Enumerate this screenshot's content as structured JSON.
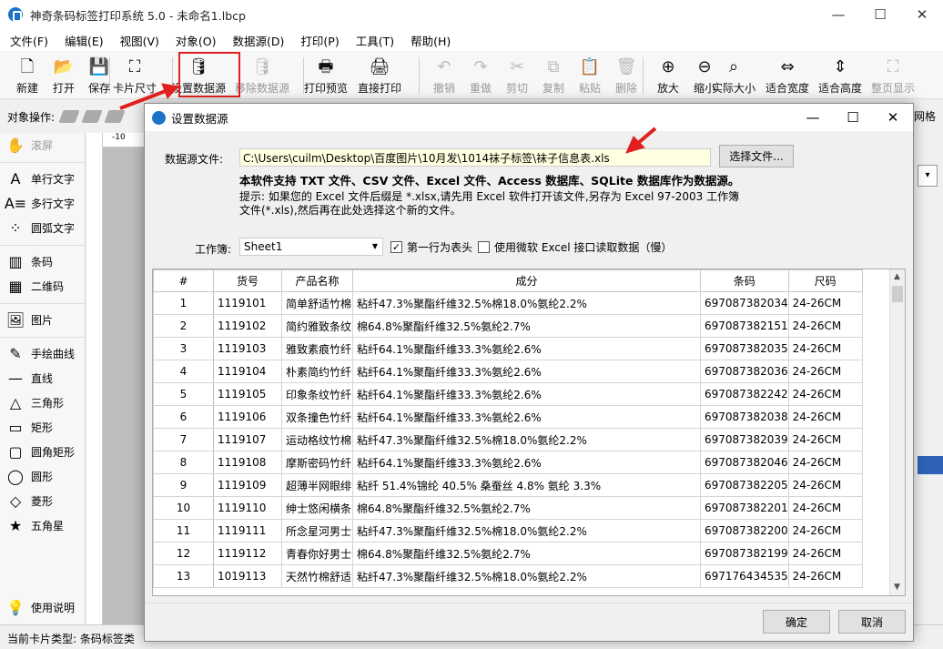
{
  "app": {
    "title": "神奇条码标签打印系统 5.0 - 未命名1.lbcp"
  },
  "window_controls": {
    "minimize": "—",
    "maximize": "☐",
    "close": "✕"
  },
  "menu": [
    "文件(F)",
    "编辑(E)",
    "视图(V)",
    "对象(O)",
    "数据源(D)",
    "打印(P)",
    "工具(T)",
    "帮助(H)"
  ],
  "toolbar": [
    {
      "label": "新建",
      "icon": "new-file-icon",
      "glyph": "🗋",
      "enabled": true
    },
    {
      "label": "打开",
      "icon": "open-icon",
      "glyph": "📂",
      "enabled": true
    },
    {
      "label": "保存",
      "icon": "save-icon",
      "glyph": "💾",
      "enabled": true
    },
    {
      "label": "卡片尺寸",
      "icon": "card-size-icon",
      "glyph": "⛶",
      "enabled": true
    },
    {
      "label": "设置数据源",
      "icon": "database-icon",
      "glyph": "🛢",
      "enabled": true
    },
    {
      "label": "移除数据源",
      "icon": "remove-database-icon",
      "glyph": "🛢",
      "enabled": false
    },
    {
      "label": "打印预览",
      "icon": "print-preview-icon",
      "glyph": "🖶",
      "enabled": true
    },
    {
      "label": "直接打印",
      "icon": "printer-icon",
      "glyph": "🖨",
      "enabled": true
    },
    {
      "label": "撤销",
      "icon": "undo-icon",
      "glyph": "↶",
      "enabled": false
    },
    {
      "label": "重做",
      "icon": "redo-icon",
      "glyph": "↷",
      "enabled": false
    },
    {
      "label": "剪切",
      "icon": "cut-icon",
      "glyph": "✂",
      "enabled": false
    },
    {
      "label": "复制",
      "icon": "copy-icon",
      "glyph": "⧉",
      "enabled": false
    },
    {
      "label": "粘贴",
      "icon": "paste-icon",
      "glyph": "📋",
      "enabled": false
    },
    {
      "label": "删除",
      "icon": "delete-icon",
      "glyph": "🗑",
      "enabled": false
    },
    {
      "label": "放大",
      "icon": "zoom-in-icon",
      "glyph": "⊕",
      "enabled": true
    },
    {
      "label": "缩小",
      "icon": "zoom-out-icon",
      "glyph": "⊖",
      "enabled": true
    },
    {
      "label": "实际大小",
      "icon": "actual-size-icon",
      "glyph": "⌕",
      "enabled": true
    },
    {
      "label": "适合宽度",
      "icon": "fit-width-icon",
      "glyph": "⇔",
      "enabled": true
    },
    {
      "label": "适合高度",
      "icon": "fit-height-icon",
      "glyph": "⇕",
      "enabled": true
    },
    {
      "label": "整页显示",
      "icon": "full-page-icon",
      "glyph": "⛶",
      "enabled": false
    }
  ],
  "object_bar": {
    "label": "对象操作:"
  },
  "left_panel": [
    {
      "label": "选择",
      "icon": "pointer-icon",
      "glyph": "➤",
      "selected": true
    },
    {
      "label": "滚屏",
      "icon": "hand-icon",
      "glyph": "✋",
      "disabled": true
    },
    {
      "label": "单行文字",
      "icon": "single-line-text-icon",
      "glyph": "A"
    },
    {
      "label": "多行文字",
      "icon": "multi-line-text-icon",
      "glyph": "A≡"
    },
    {
      "label": "圆弧文字",
      "icon": "arc-text-icon",
      "glyph": "⁘"
    },
    {
      "label": "条码",
      "icon": "barcode-icon",
      "glyph": "▥"
    },
    {
      "label": "二维码",
      "icon": "qrcode-icon",
      "glyph": "▦"
    },
    {
      "label": "图片",
      "icon": "image-icon",
      "glyph": "🖼"
    },
    {
      "label": "手绘曲线",
      "icon": "pen-icon",
      "glyph": "✎"
    },
    {
      "label": "直线",
      "icon": "line-icon",
      "glyph": "—"
    },
    {
      "label": "三角形",
      "icon": "triangle-icon",
      "glyph": "△"
    },
    {
      "label": "矩形",
      "icon": "rectangle-icon",
      "glyph": "▭"
    },
    {
      "label": "圆角矩形",
      "icon": "rounded-rectangle-icon",
      "glyph": "▢"
    },
    {
      "label": "圆形",
      "icon": "circle-icon",
      "glyph": "◯"
    },
    {
      "label": "菱形",
      "icon": "diamond-icon",
      "glyph": "◇"
    },
    {
      "label": "五角星",
      "icon": "star-icon",
      "glyph": "★"
    }
  ],
  "help": {
    "label": "使用说明",
    "icon": "lightbulb-icon",
    "glyph": "💡"
  },
  "ruler": {
    "h_label": "-10"
  },
  "right_panel": {
    "label": "网格"
  },
  "status": {
    "text": "当前卡片类型: 条码标签类"
  },
  "dialog": {
    "title": "设置数据源",
    "file_label": "数据源文件:",
    "file_path": "C:\\Users\\cuilm\\Desktop\\百度图片\\10月发\\1014袜子标签\\袜子信息表.xls",
    "choose_button": "选择文件...",
    "support_text": "本软件支持 TXT 文件、CSV 文件、Excel 文件、Access 数据库、SQLite 数据库作为数据源。",
    "tip_text": "提示: 如果您的 Excel 文件后缀是 *.xlsx,请先用 Excel 软件打开该文件,另存为 Excel 97-2003 工作簿文件(*.xls),然后再在此处选择这个新的文件。",
    "sheet_label": "工作簿:",
    "sheet_value": "Sheet1",
    "first_row_header": "第一行为表头",
    "use_ms_excel": "使用微软 Excel 接口读取数据（慢）",
    "ok": "确定",
    "cancel": "取消",
    "table": {
      "columns": [
        "#",
        "货号",
        "产品名称",
        "成分",
        "条码",
        "尺码"
      ],
      "rows": [
        [
          "1",
          "1119101",
          "简单舒适竹棉",
          "粘纤47.3%聚酯纤维32.5%棉18.0%氨纶2.2%",
          "697087382034",
          "24-26CM"
        ],
        [
          "2",
          "1119102",
          "简约雅致条纹",
          "棉64.8%聚酯纤维32.5%氨纶2.7%",
          "697087382151",
          "24-26CM"
        ],
        [
          "3",
          "1119103",
          "雅致素痕竹纤",
          "粘纤64.1%聚酯纤维33.3%氨纶2.6%",
          "697087382035",
          "24-26CM"
        ],
        [
          "4",
          "1119104",
          "朴素简约竹纤",
          "粘纤64.1%聚酯纤维33.3%氨纶2.6%",
          "697087382036",
          "24-26CM"
        ],
        [
          "5",
          "1119105",
          "印象条纹竹纤",
          "粘纤64.1%聚酯纤维33.3%氨纶2.6%",
          "697087382242",
          "24-26CM"
        ],
        [
          "6",
          "1119106",
          "双条撞色竹纤",
          "粘纤64.1%聚酯纤维33.3%氨纶2.6%",
          "697087382038",
          "24-26CM"
        ],
        [
          "7",
          "1119107",
          "运动格纹竹棉",
          "粘纤47.3%聚酯纤维32.5%棉18.0%氨纶2.2%",
          "697087382039",
          "24-26CM"
        ],
        [
          "8",
          "1119108",
          "摩斯密码竹纤",
          "粘纤64.1%聚酯纤维33.3%氨纶2.6%",
          "697087382046",
          "24-26CM"
        ],
        [
          "9",
          "1119109",
          "超薄半网眼绯",
          "粘纤 51.4%锦纶 40.5% 桑蚕丝 4.8% 氨纶 3.3%",
          "697087382205",
          "24-26CM"
        ],
        [
          "10",
          "1119110",
          "绅士悠闲横条",
          "棉64.8%聚酯纤维32.5%氨纶2.7%",
          "697087382201",
          "24-26CM"
        ],
        [
          "11",
          "1119111",
          "所念星河男士",
          "粘纤47.3%聚酯纤维32.5%棉18.0%氨纶2.2%",
          "697087382200",
          "24-26CM"
        ],
        [
          "12",
          "1119112",
          "青春你好男士",
          "棉64.8%聚酯纤维32.5%氨纶2.7%",
          "697087382199",
          "24-26CM"
        ],
        [
          "13",
          "1019113",
          "天然竹棉舒适",
          "粘纤47.3%聚酯纤维32.5%棉18.0%氨纶2.2%",
          "697176434535",
          "24-26CM"
        ]
      ]
    }
  },
  "colors": {
    "highlight": "#e02020",
    "accent": "#2f62b5",
    "file_bg": "#ffffe1"
  }
}
